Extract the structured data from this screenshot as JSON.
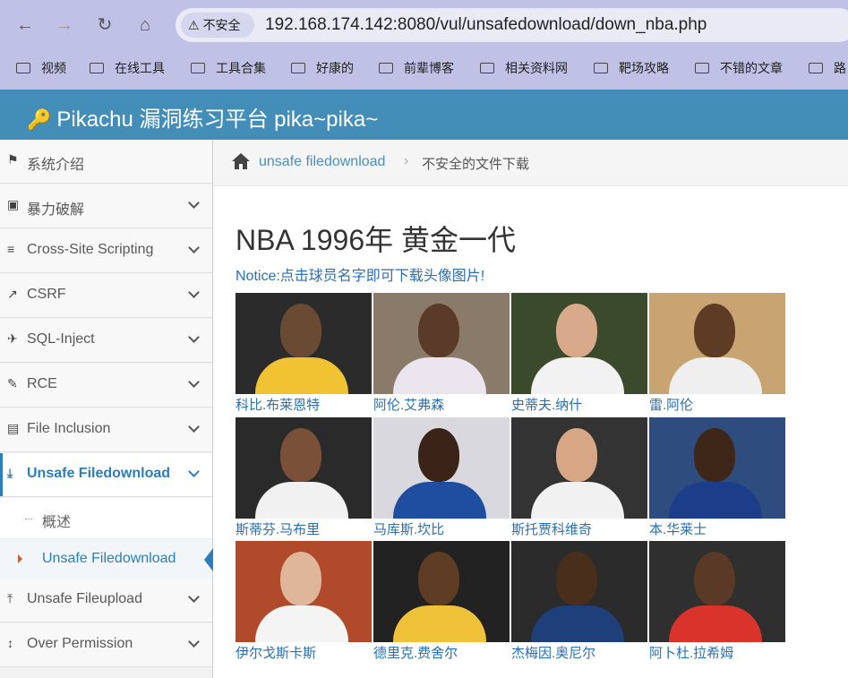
{
  "browser": {
    "security_label": "不安全",
    "url": "192.168.174.142:8080/vul/unsafedownload/down_nba.php",
    "bookmarks": [
      "视频",
      "在线工具",
      "工具合集",
      "好康的",
      "前辈博客",
      "相关资料网",
      "靶场攻略",
      "不错的文章",
      "路"
    ]
  },
  "app": {
    "title": "Pikachu 漏洞练习平台 pika~pika~"
  },
  "sidebar": {
    "items": [
      {
        "label": "系统介绍",
        "icon": "tags-icon"
      },
      {
        "label": "暴力破解",
        "icon": "lock-icon"
      },
      {
        "label": "Cross-Site Scripting",
        "icon": "list-icon"
      },
      {
        "label": "CSRF",
        "icon": "share-icon"
      },
      {
        "label": "SQL-Inject",
        "icon": "plane-icon"
      },
      {
        "label": "RCE",
        "icon": "pencil-icon"
      },
      {
        "label": "File Inclusion",
        "icon": "file-icon"
      },
      {
        "label": "Unsafe Filedownload",
        "icon": "download-icon"
      },
      {
        "label": "Unsafe Fileupload",
        "icon": "upload-icon"
      },
      {
        "label": "Over Permission",
        "icon": "text-height-icon"
      }
    ],
    "subitems": [
      {
        "label": "概述"
      },
      {
        "label": "Unsafe Filedownload"
      }
    ]
  },
  "breadcrumb": {
    "link": "unsafe filedownload",
    "current": "不安全的文件下载"
  },
  "main": {
    "title": "NBA 1996年 黄金一代",
    "notice": "Notice:点击球员名字即可下载头像图片!",
    "players": [
      {
        "name": "科比.布莱恩特",
        "bg": "#2b2b2b",
        "jersey": "#f1c232",
        "skin": "#6b4a33"
      },
      {
        "name": "阿伦.艾弗森",
        "bg": "#8a7a6a",
        "jersey": "#e9e4ee",
        "skin": "#5a3a28"
      },
      {
        "name": "史蒂夫.纳什",
        "bg": "#3c4a2c",
        "jersey": "#f2f2f2",
        "skin": "#d8a98a"
      },
      {
        "name": "雷.阿伦",
        "bg": "#c8a472",
        "jersey": "#efefef",
        "skin": "#5e3b25"
      },
      {
        "name": "斯蒂芬.马布里",
        "bg": "#2a2a2a",
        "jersey": "#f1f1f1",
        "skin": "#7a5038"
      },
      {
        "name": "马库斯.坎比",
        "bg": "#d8d8de",
        "jersey": "#1f4ea0",
        "skin": "#3a2418"
      },
      {
        "name": "斯托贾科维奇",
        "bg": "#333333",
        "jersey": "#f1f1f1",
        "skin": "#d7a684"
      },
      {
        "name": "本.华莱士",
        "bg": "#2f4c7e",
        "jersey": "#1c3e8a",
        "skin": "#3e2618"
      },
      {
        "name": "伊尔戈斯卡斯",
        "bg": "#b04a2a",
        "jersey": "#f4f4f4",
        "skin": "#dfb69a"
      },
      {
        "name": "德里克.费舍尔",
        "bg": "#222222",
        "jersey": "#f0c23a",
        "skin": "#5f3c24"
      },
      {
        "name": "杰梅因.奥尼尔",
        "bg": "#2b2b2b",
        "jersey": "#1f3f7a",
        "skin": "#4a2e1c"
      },
      {
        "name": "阿卜杜.拉希姆",
        "bg": "#2f2f2f",
        "jersey": "#d9332b",
        "skin": "#5a3926"
      }
    ]
  }
}
